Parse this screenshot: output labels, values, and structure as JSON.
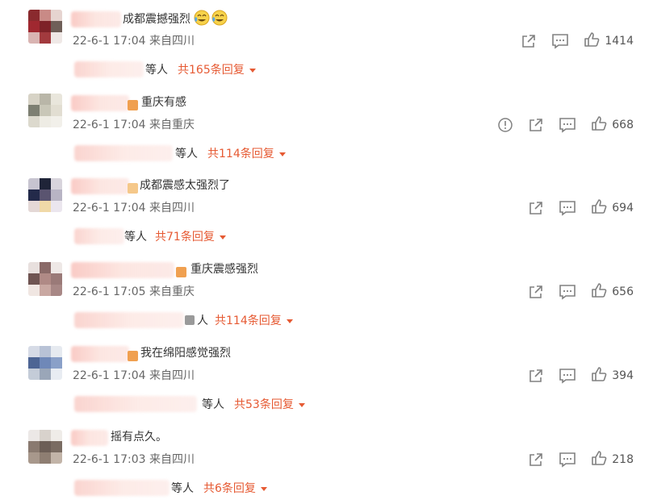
{
  "comments": [
    {
      "text": "成都震撼强烈",
      "meta": "22-6-1 17:04 来自四川",
      "likes": "1414",
      "reply_etc": "等人",
      "reply_count": "共165条回复",
      "has_report": false
    },
    {
      "text": "重庆有感",
      "meta": "22-6-1 17:04 来自重庆",
      "likes": "668",
      "reply_etc": "等人",
      "reply_count": "共114条回复",
      "has_report": true
    },
    {
      "text": "成都震感太强烈了",
      "meta": "22-6-1 17:04 来自四川",
      "likes": "694",
      "reply_etc": "等人",
      "reply_count": "共71条回复",
      "has_report": false
    },
    {
      "text": "重庆震感强烈",
      "meta": "22-6-1 17:05 来自重庆",
      "likes": "656",
      "reply_etc": "人",
      "reply_count": "共114条回复",
      "has_report": false
    },
    {
      "text": "我在绵阳感觉强烈",
      "meta": "22-6-1 17:04 来自四川",
      "likes": "394",
      "reply_etc": "等人",
      "reply_count": "共53条回复",
      "has_report": false
    },
    {
      "text": "摇有点久。",
      "meta": "22-6-1 17:03 来自四川",
      "likes": "218",
      "reply_etc": "等人",
      "reply_count": "共6条回复",
      "has_report": false
    }
  ],
  "icons": {
    "share": "share-icon",
    "comment": "comment-icon",
    "like": "thumbs-up-icon",
    "report": "report-icon",
    "emoji": "laughing-cry-emoji-icon",
    "reply_caret": "caret-down-icon"
  },
  "colors": {
    "accent": "#e65a33",
    "meta": "#666666",
    "text": "#333333",
    "icon": "#808080"
  }
}
